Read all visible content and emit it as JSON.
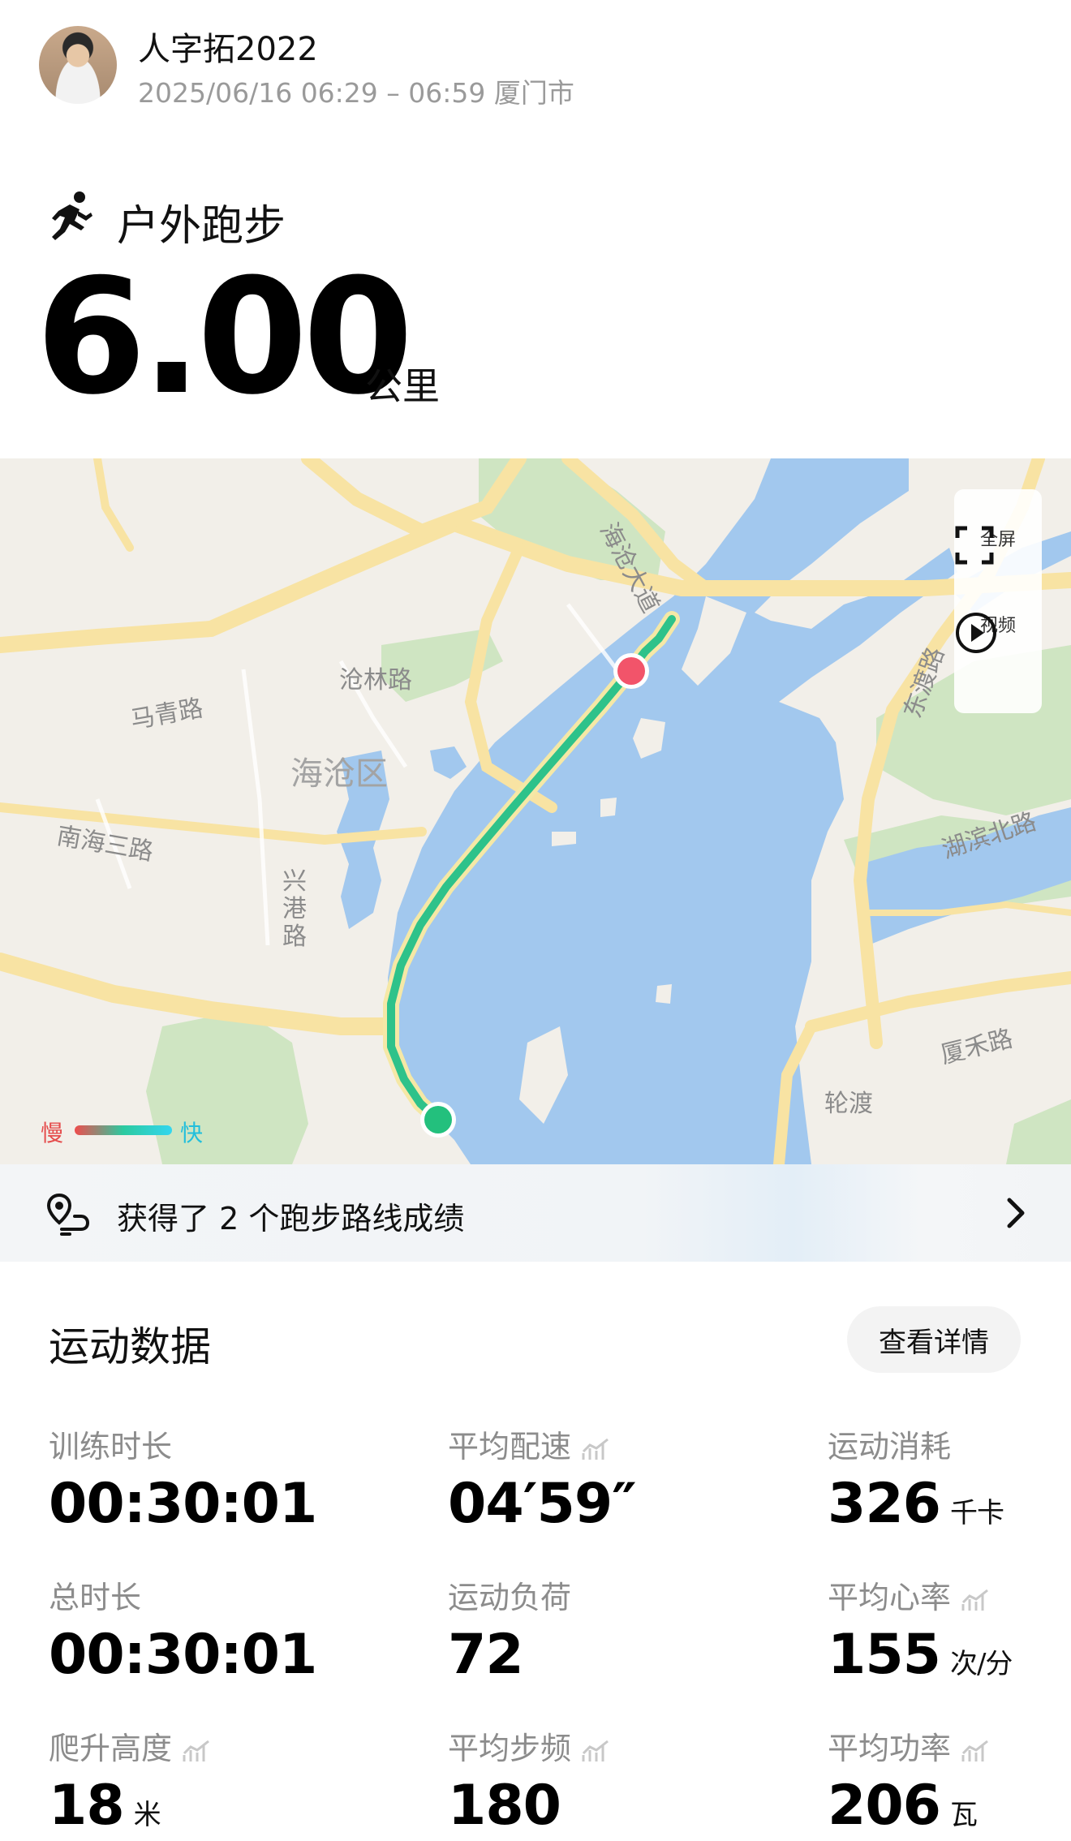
{
  "header": {
    "user_name": "人字拓2022",
    "meta": "2025/06/16 06:29 – 06:59 厦门市"
  },
  "activity": {
    "title": "户外跑步",
    "distance": "6.00",
    "distance_unit": "公里"
  },
  "map": {
    "labels": {
      "canglin_road": "沧林路",
      "haicang_district": "海沧区",
      "maqing_road": "马青路",
      "nanhai_3rd_road": "南海三路",
      "xinggang_road": "兴港路",
      "haicang_avenue": "海沧大道",
      "dongdu_road": "东渡路",
      "hubin_north_road": "湖滨北路",
      "xiahe_road": "厦禾路",
      "lundu": "轮渡"
    },
    "controls": {
      "fullscreen": "全屏",
      "video": "视频"
    },
    "legend": {
      "slow": "慢",
      "fast": "快"
    },
    "colors": {
      "water": "#a2c8ee",
      "land": "#f2efe9",
      "road": "#f8e3a3",
      "park": "#cfe5c2",
      "route": "#2ec28a",
      "start": "#23c07d",
      "end": "#f2546a"
    }
  },
  "achievement": {
    "text": "获得了 2 个跑步路线成绩"
  },
  "stats": {
    "section_title": "运动数据",
    "details_button": "查看详情",
    "items": [
      {
        "label": "训练时长",
        "value": "00:30:01",
        "unit": ""
      },
      {
        "label": "平均配速",
        "value": "04′59″",
        "unit": ""
      },
      {
        "label": "运动消耗",
        "value": "326",
        "unit": "千卡"
      },
      {
        "label": "总时长",
        "value": "00:30:01",
        "unit": ""
      },
      {
        "label": "运动负荷",
        "value": "72",
        "unit": ""
      },
      {
        "label": "平均心率",
        "value": "155",
        "unit": "次/分"
      },
      {
        "label": "爬升高度",
        "value": "18",
        "unit": "米"
      },
      {
        "label": "平均步频",
        "value": "180",
        "unit": ""
      },
      {
        "label": "平均功率",
        "value": "206",
        "unit": "瓦"
      }
    ]
  }
}
